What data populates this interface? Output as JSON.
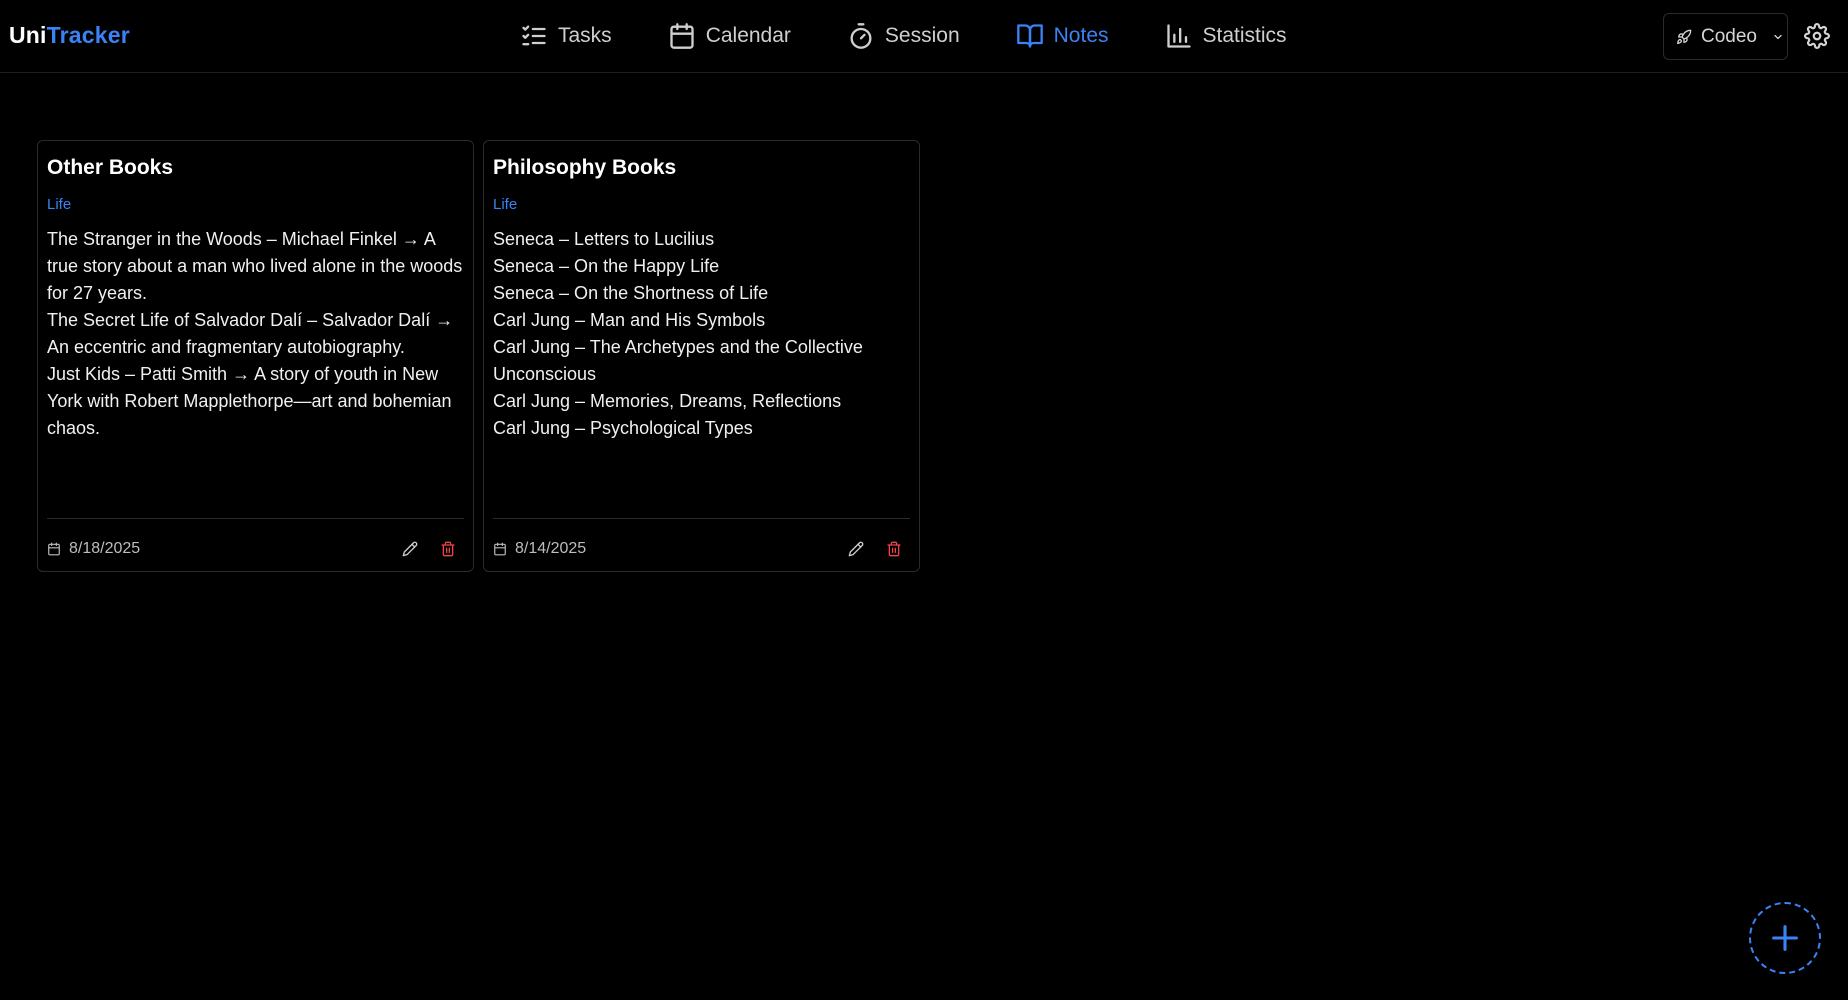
{
  "brand": {
    "part1": "Uni",
    "part2": "Tracker"
  },
  "nav": {
    "items": [
      {
        "label": "Tasks",
        "icon": "list-checks-icon"
      },
      {
        "label": "Calendar",
        "icon": "calendar-icon"
      },
      {
        "label": "Session",
        "icon": "timer-icon"
      },
      {
        "label": "Notes",
        "icon": "book-open-icon",
        "active": true
      },
      {
        "label": "Statistics",
        "icon": "bar-chart-icon"
      }
    ]
  },
  "workspace": {
    "label": "Codeo",
    "icon": "rocket-icon"
  },
  "settings": {
    "icon": "gear-icon"
  },
  "notes": [
    {
      "title": "Other Books",
      "tag": "Life",
      "lines": [
        "The Stranger in the Woods – Michael Finkel → A",
        "true story about a man who lived alone in the woods",
        "for 27 years.",
        "The Secret Life of Salvador Dalí – Salvador Dalí →",
        "An eccentric and fragmentary autobiography.",
        "Just Kids – Patti Smith → A story of youth in New",
        "York with Robert Mapplethorpe—art and bohemian",
        "chaos."
      ],
      "date": "8/18/2025"
    },
    {
      "title": "Philosophy Books",
      "tag": "Life",
      "lines": [
        "Seneca – Letters to Lucilius",
        "Seneca – On the Happy Life",
        "Seneca – On the Shortness of Life",
        "Carl Jung – Man and His Symbols",
        "Carl Jung – The Archetypes and the Collective",
        "Unconscious",
        "Carl Jung – Memories, Dreams, Reflections",
        "Carl Jung – Psychological Types"
      ],
      "date": "8/14/2025"
    }
  ],
  "fab": {
    "icon": "plus-icon"
  },
  "colors": {
    "accent": "#3b82f6",
    "danger": "#ef4444",
    "background": "#000000"
  }
}
